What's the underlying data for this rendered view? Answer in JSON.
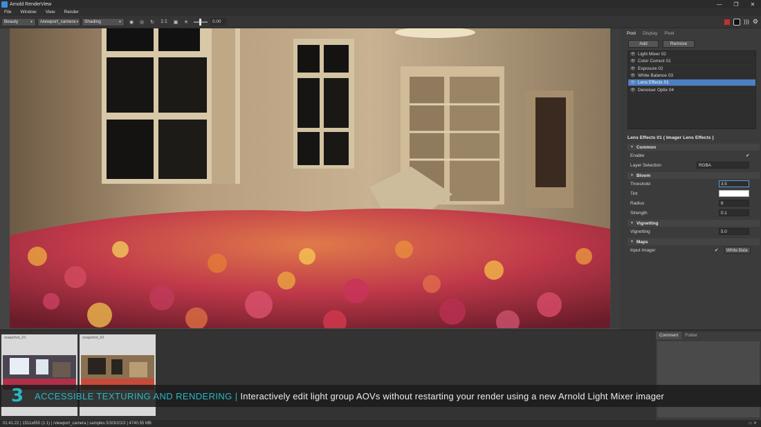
{
  "window": {
    "title": "Arnold RenderView",
    "controls": [
      "—",
      "❐",
      "✕"
    ]
  },
  "menu": [
    "File",
    "Window",
    "View",
    "Render"
  ],
  "toolbar": {
    "aov": "Beauty",
    "camera": "/viewport_camera",
    "shading": "Shading",
    "ratio": "1:1",
    "exposure": "0.00"
  },
  "panel": {
    "tabs": [
      "Post",
      "Display",
      "Pixel"
    ],
    "add_label": "Add",
    "remove_label": "Remove",
    "imagers": [
      "Light Mixer 02",
      "Color Correct 01",
      "Exposure 02",
      "White Balance 03",
      "Lens Effects 01",
      "Denoiser Optix 04"
    ],
    "selected_index": 4,
    "section_title": "Lens Effects 01  ( Imager Lens Effects )",
    "common": {
      "title": "Common",
      "enable_label": "Enable",
      "enable_check": "✔",
      "layer_label": "Layer Selection",
      "layer_value": "RGBA"
    },
    "bloom": {
      "title": "Bloom",
      "threshold_label": "Threshold",
      "threshold_value": "3.5",
      "tint_label": "Tint",
      "radius_label": "Radius",
      "radius_value": "6",
      "strength_label": "Strength",
      "strength_value": "0.1"
    },
    "vignetting": {
      "title": "Vignetting",
      "label": "Vignetting",
      "value": "5.0"
    },
    "maps": {
      "title": "Maps",
      "input_label": "Input Imager",
      "input_check": "✔",
      "input_value": "White Bala"
    }
  },
  "snapshots": [
    "snapshot_01",
    "snapshot_02"
  ],
  "comment_tabs": [
    "Comment",
    "Folder"
  ],
  "banner": {
    "number": "3",
    "highlight": "ACCESSIBLE TEXTURING AND RENDERING |",
    "text": "Interactively edit light group AOVs without restarting your render using a new Arnold Light Mixer imager"
  },
  "status": {
    "text": "01:41:22 | 1511x850 (1:1) | /viewport_camera | samples 5/3/3/2/2/2 | 4740.55 MB"
  },
  "colors": {
    "accent": "#27b9c3",
    "selection": "#4d7fc2",
    "stop": "#c0322e"
  }
}
